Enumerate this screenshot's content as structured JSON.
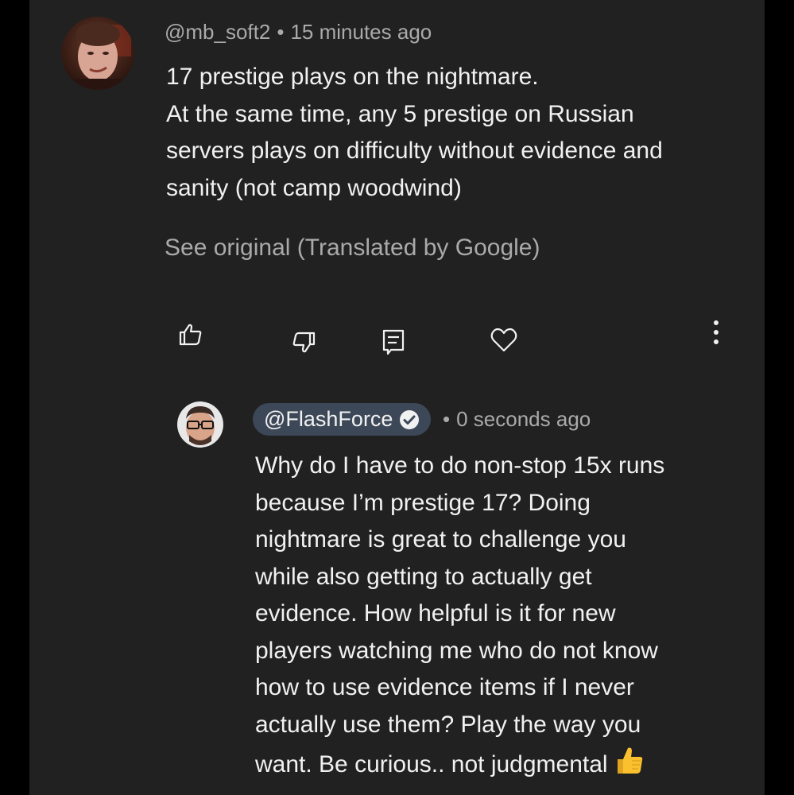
{
  "colors": {
    "panel_background": "#212121",
    "outer_background": "#000000",
    "primary_text": "#f1f1f1",
    "secondary_text": "#aaaaaa",
    "handle_pill": "#3c4757"
  },
  "comment": {
    "username": "@mb_soft2",
    "separator": "•",
    "time": "15 minutes ago",
    "text_lines": [
      "17 prestige plays on the nightmare.",
      "At the same time, any 5 prestige on Russian",
      "servers plays on difficulty without evidence and",
      "sanity (not camp woodwind)"
    ],
    "see_original": "See original (Translated by Google)",
    "actions": [
      "thumbs-up-icon",
      "thumbs-down-icon",
      "reply-icon",
      "heart-icon",
      "more-vertical-icon"
    ]
  },
  "reply": {
    "username": "@FlashForce",
    "verified": true,
    "separator": "•",
    "time": "0 seconds ago",
    "text_lines": [
      "Why do I have to do non-stop 15x runs",
      "because I’m prestige 17? Doing",
      "nightmare is great to challenge you",
      "while also getting to actually get",
      "evidence. How helpful is it for new",
      "players watching me who do not know",
      "how to use evidence items if I never",
      "actually use them? Play the way you",
      "want. Be curious.. not judgmental"
    ],
    "trailing_emoji": "thumbs-up-emoji-icon"
  }
}
